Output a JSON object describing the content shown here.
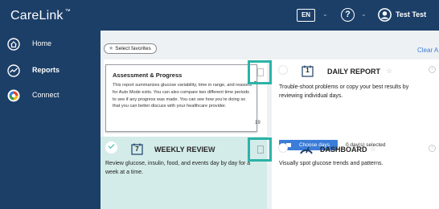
{
  "header": {
    "logo": "CareLink",
    "logo_tm": "™",
    "language": "EN",
    "help": "?",
    "user": "Test Test",
    "chevron": "⌄"
  },
  "sidebar": {
    "items": [
      {
        "label": "Home",
        "icon": "home-icon"
      },
      {
        "label": "Reports",
        "icon": "reports-icon"
      },
      {
        "label": "Connect",
        "icon": "connect-icon"
      }
    ]
  },
  "toolbar": {
    "select_favorites": "Select favorites",
    "clear_all": "Clear A"
  },
  "assessment": {
    "title": "Assessment & Progress",
    "body": "This report summarizes glucose variability, time in range, and reasons for Auto Mode exits. You can also compare two different time periods to see if any progress was made. You can see how you're doing so that you can better discuss with your healthcare provider.",
    "number": "19"
  },
  "daily_report": {
    "calendar_num": "1",
    "title": "DAILY REPORT",
    "star": "☆",
    "desc": "Trouble-shoot problems or copy your best results by reviewing individual days.",
    "choose_btn": "Choose days",
    "selected": "0 day(s) selected"
  },
  "weekly_review": {
    "calendar_num": "7",
    "title": "WEEKLY REVIEW",
    "star": "☆",
    "desc": "Review glucose, insulin, food, and events day by day for a week at a time."
  },
  "dashboard": {
    "title": "DASHBOARD",
    "star": "☆",
    "desc": "Visually spot glucose trends and patterns."
  },
  "colors": {
    "navy": "#1c3f68",
    "teal": "#2bb3a7",
    "blue": "#3b7dd8",
    "card_teal": "#d4ece9"
  }
}
